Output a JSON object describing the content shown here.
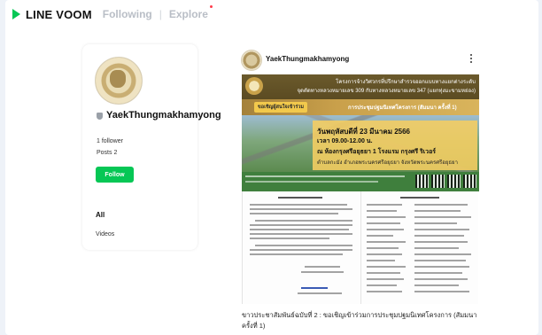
{
  "brand": {
    "logo_text": "LINE VOOM",
    "accent": "#06c755"
  },
  "nav": {
    "following": "Following",
    "separator": "|",
    "explore": "Explore"
  },
  "profile": {
    "name": "YaekThungmakhamyong",
    "followers": "1 follower",
    "posts": "Posts 2",
    "follow_label": "Follow",
    "tabs": [
      "All",
      "Videos"
    ]
  },
  "post": {
    "author": "YaekThungmakhamyong",
    "image": {
      "header_line1": "โครงการจ้างวิศวกรที่ปรึกษาสำรวจออกแบบทางแยกต่างระดับ",
      "header_line2": "จุดตัดทางหลวงหมายเลข 309 กับทางหลวงหมายเลข 347 (แยกทุ่งมะขามหย่อง)",
      "invite": "ขอเชิญผู้สนใจเข้าร่วม",
      "meeting": "การประชุมปฐมนิเทศโครงการ (สัมมนา ครั้งที่ 1)",
      "date": "วันพฤหัสบดีที่ 23 มีนาคม 2566",
      "time": "เวลา 09.00-12.00 น.",
      "venue": "ณ ห้องกรุงศรีอยุธยา 1 โรงแรม กรุงศรี ริเวอร์",
      "address": "ตำบลกะมัง อำเภอพระนครศรีอยุธยา จังหวัดพระนครศรีอยุธยา"
    },
    "caption": "ขาวประชาสัมพันธ์ฉบับที่ 2 : ขอเชิญเข้าร่วมการประชุมปฐมนิเทศโครงการ (สัมมนา ครั้งที่ 1)"
  }
}
